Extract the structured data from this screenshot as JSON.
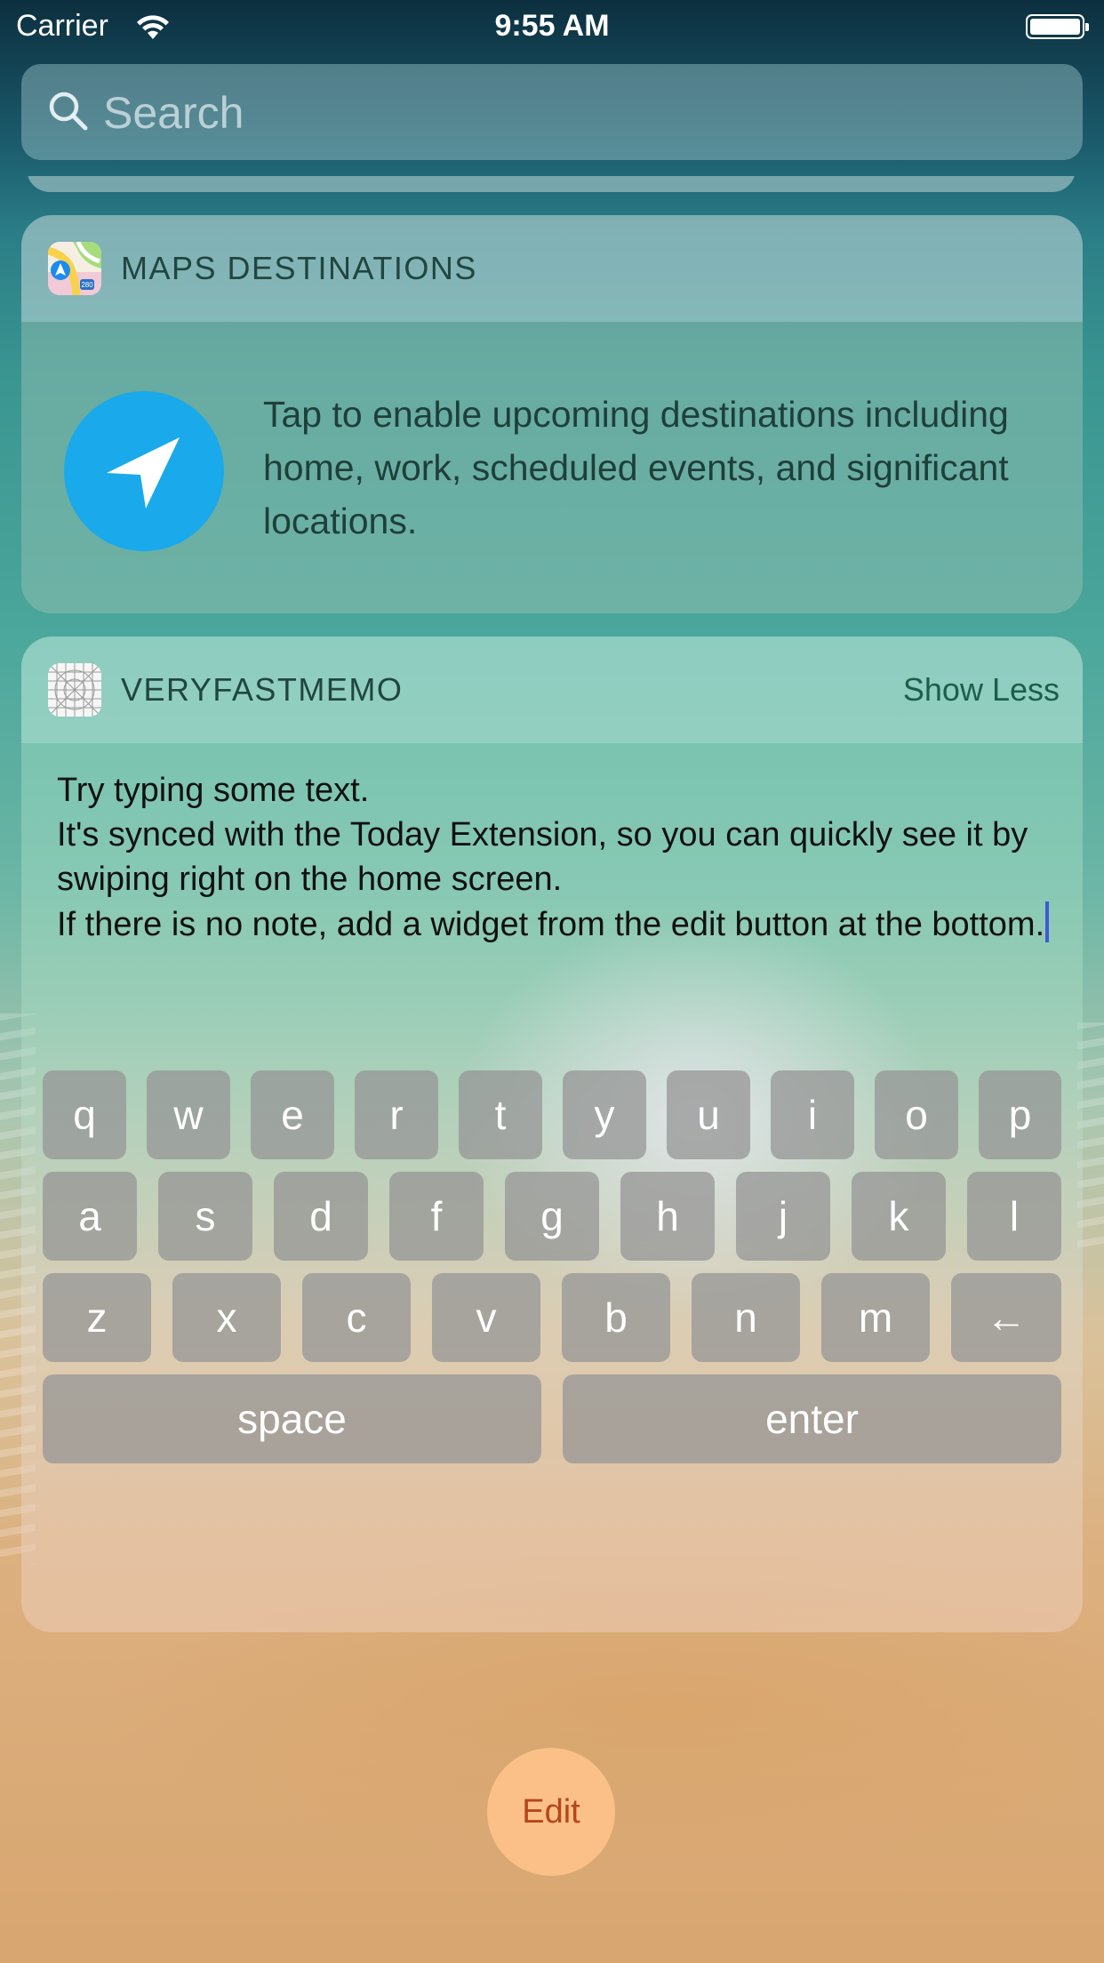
{
  "status_bar": {
    "carrier": "Carrier",
    "time": "9:55 AM"
  },
  "search": {
    "placeholder": "Search"
  },
  "maps_widget": {
    "title": "MAPS DESTINATIONS",
    "message": "Tap to enable upcoming destinations including home, work, scheduled events, and significant locations.",
    "icon_badge": "280"
  },
  "memo_widget": {
    "title": "VERYFASTMEMO",
    "show_less_label": "Show Less",
    "text": "Try typing some text.\nIt's synced with the Today Extension, so you can quickly see it by swiping right on the home screen.\nIf there is no note, add a widget from the edit button at the bottom."
  },
  "keyboard": {
    "row1": [
      "q",
      "w",
      "e",
      "r",
      "t",
      "y",
      "u",
      "i",
      "o",
      "p"
    ],
    "row2": [
      "a",
      "s",
      "d",
      "f",
      "g",
      "h",
      "j",
      "k",
      "l"
    ],
    "row3": [
      "z",
      "x",
      "c",
      "v",
      "b",
      "n",
      "m",
      "←"
    ],
    "space_label": "space",
    "enter_label": "enter"
  },
  "edit_label": "Edit",
  "colors": {
    "nav_circle": "#1aa9ea",
    "caret": "#3d5ad4",
    "edit_text": "#b5461c",
    "show_less": "#1b5e4a"
  }
}
